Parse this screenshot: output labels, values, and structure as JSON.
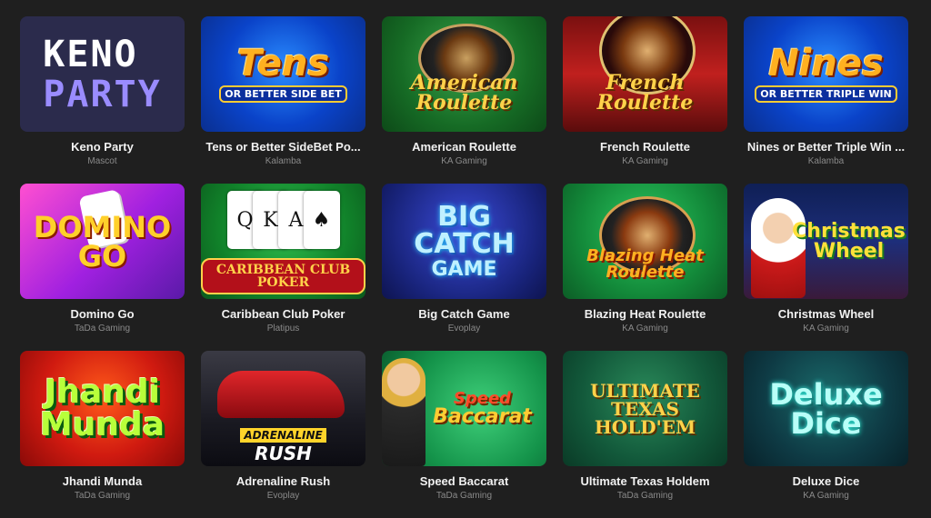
{
  "games": [
    {
      "name": "Keno Party",
      "provider": "Mascot",
      "thumb_line1": "KENO",
      "thumb_line2": "PARTY"
    },
    {
      "name": "Tens or Better SideBet Po...",
      "provider": "Kalamba",
      "thumb_line1": "Tens",
      "thumb_line2": "OR BETTER SIDE BET"
    },
    {
      "name": "American Roulette",
      "provider": "KA Gaming",
      "thumb_line1": "American Roulette",
      "thumb_line2": ""
    },
    {
      "name": "French Roulette",
      "provider": "KA Gaming",
      "thumb_line1": "French Roulette",
      "thumb_line2": ""
    },
    {
      "name": "Nines or Better Triple Win ...",
      "provider": "Kalamba",
      "thumb_line1": "Nines",
      "thumb_line2": "OR BETTER TRIPLE WIN"
    },
    {
      "name": "Domino Go",
      "provider": "TaDa Gaming",
      "thumb_line1": "DOMINO GO",
      "thumb_line2": ""
    },
    {
      "name": "Caribbean Club Poker",
      "provider": "Platipus",
      "thumb_line1": "CARIBBEAN CLUB POKER",
      "thumb_line2": ""
    },
    {
      "name": "Big Catch Game",
      "provider": "Evoplay",
      "thumb_line1": "BIG CATCH",
      "thumb_line2": "GAME"
    },
    {
      "name": "Blazing Heat Roulette",
      "provider": "KA Gaming",
      "thumb_line1": "Blazing Heat Roulette",
      "thumb_line2": ""
    },
    {
      "name": "Christmas Wheel",
      "provider": "KA Gaming",
      "thumb_line1": "Christmas Wheel",
      "thumb_line2": ""
    },
    {
      "name": "Jhandi Munda",
      "provider": "TaDa Gaming",
      "thumb_line1": "Jhandi Munda",
      "thumb_line2": ""
    },
    {
      "name": "Adrenaline Rush",
      "provider": "Evoplay",
      "thumb_line1": "ADRENALINE",
      "thumb_line2": "RUSH"
    },
    {
      "name": "Speed Baccarat",
      "provider": "TaDa Gaming",
      "thumb_line1": "Speed",
      "thumb_line2": "Baccarat"
    },
    {
      "name": "Ultimate Texas Holdem",
      "provider": "TaDa Gaming",
      "thumb_line1": "ULTIMATE TEXAS HOLD'EM",
      "thumb_line2": ""
    },
    {
      "name": "Deluxe Dice",
      "provider": "KA Gaming",
      "thumb_line1": "Deluxe Dice",
      "thumb_line2": ""
    }
  ],
  "card_symbols": {
    "q": "Q",
    "k": "K",
    "a": "A",
    "spade": "♠"
  }
}
